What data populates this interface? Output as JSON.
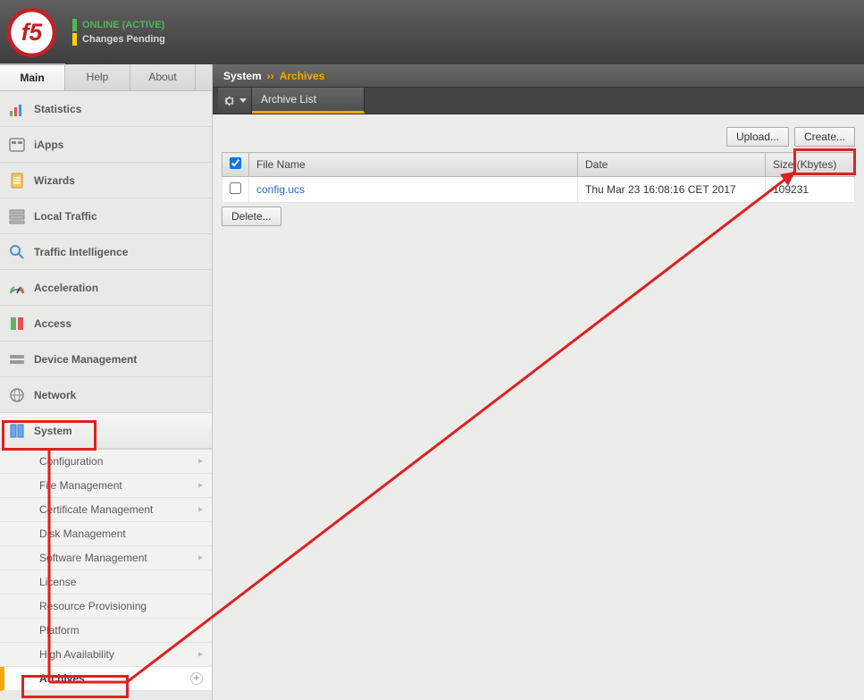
{
  "header": {
    "status1": "ONLINE (ACTIVE)",
    "status2": "Changes Pending"
  },
  "navTabs": {
    "main": "Main",
    "help": "Help",
    "about": "About"
  },
  "menu": [
    {
      "label": "Statistics"
    },
    {
      "label": "iApps"
    },
    {
      "label": "Wizards"
    },
    {
      "label": "Local Traffic"
    },
    {
      "label": "Traffic Intelligence"
    },
    {
      "label": "Acceleration"
    },
    {
      "label": "Access"
    },
    {
      "label": "Device Management"
    },
    {
      "label": "Network"
    },
    {
      "label": "System"
    }
  ],
  "systemSub": [
    {
      "label": "Configuration",
      "hasSub": true
    },
    {
      "label": "File Management",
      "hasSub": true
    },
    {
      "label": "Certificate Management",
      "hasSub": true
    },
    {
      "label": "Disk Management",
      "hasSub": false
    },
    {
      "label": "Software Management",
      "hasSub": true
    },
    {
      "label": "License",
      "hasSub": false
    },
    {
      "label": "Resource Provisioning",
      "hasSub": false
    },
    {
      "label": "Platform",
      "hasSub": false
    },
    {
      "label": "High Availability",
      "hasSub": true
    },
    {
      "label": "Archives",
      "hasSub": false,
      "active": true
    }
  ],
  "breadcrumb": {
    "root": "System",
    "current": "Archives"
  },
  "subtab": "Archive List",
  "actions": {
    "upload": "Upload...",
    "create": "Create...",
    "delete": "Delete..."
  },
  "table": {
    "headers": {
      "fname": "File Name",
      "date": "Date",
      "size": "Size (Kbytes)"
    },
    "rows": [
      {
        "fname": "config.ucs",
        "date": "Thu Mar 23 16:08:16 CET 2017",
        "size": "109231"
      }
    ]
  }
}
